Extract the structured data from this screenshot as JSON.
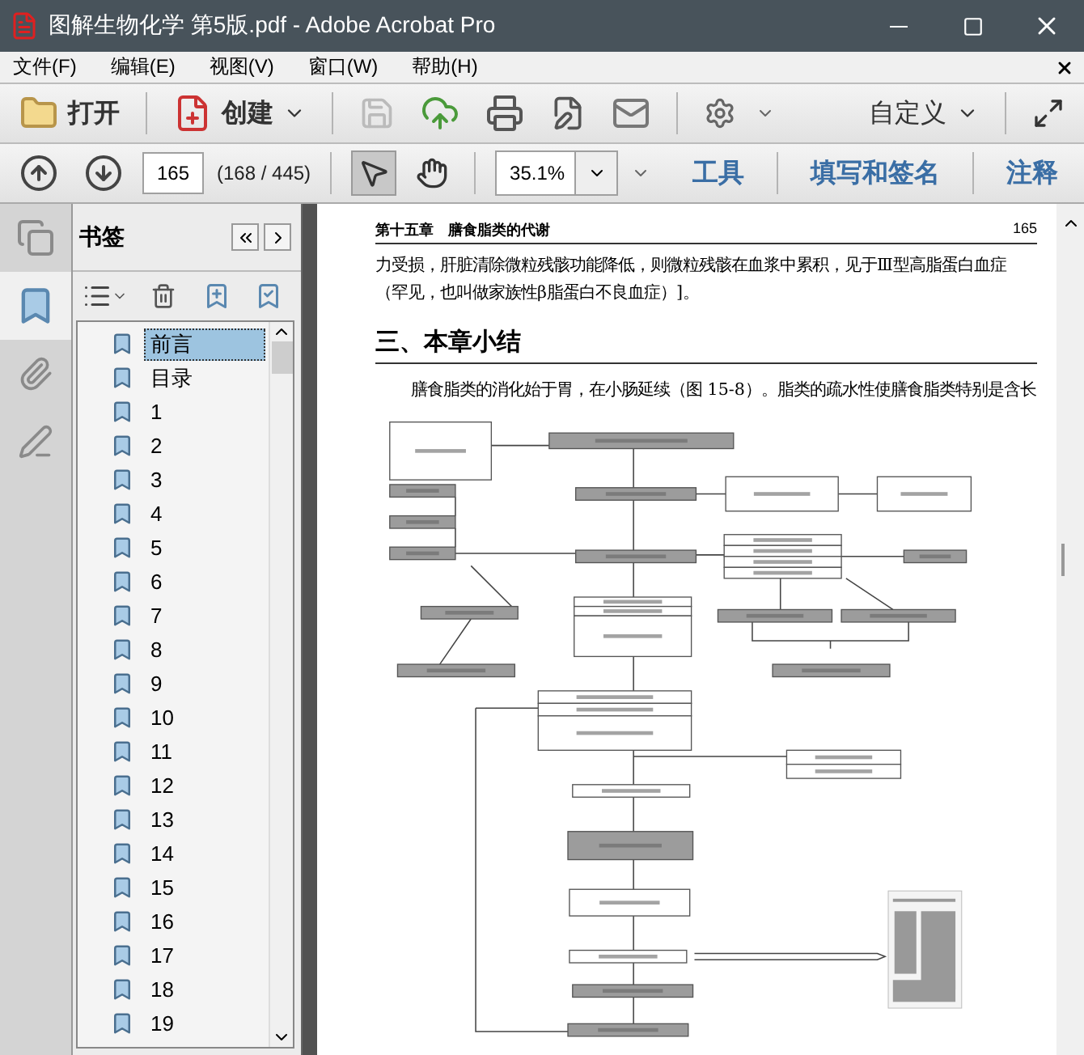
{
  "window": {
    "title": "图解生物化学 第5版.pdf - Adobe Acrobat Pro"
  },
  "menu": [
    "文件(F)",
    "编辑(E)",
    "视图(V)",
    "窗口(W)",
    "帮助(H)"
  ],
  "toolbar": {
    "open": "打开",
    "create": "创建",
    "customize": "自定义"
  },
  "nav": {
    "page": "165",
    "page_count": "(168 / 445)",
    "zoom": "35.1%",
    "links": [
      "工具",
      "填写和签名",
      "注释"
    ]
  },
  "sidebar": {
    "title": "书签",
    "bookmarks": [
      {
        "label": "前言",
        "selected": true
      },
      {
        "label": "目录",
        "selected": false
      },
      {
        "label": "1",
        "selected": false
      },
      {
        "label": "2",
        "selected": false
      },
      {
        "label": "3",
        "selected": false
      },
      {
        "label": "4",
        "selected": false
      },
      {
        "label": "5",
        "selected": false
      },
      {
        "label": "6",
        "selected": false
      },
      {
        "label": "7",
        "selected": false
      },
      {
        "label": "8",
        "selected": false
      },
      {
        "label": "9",
        "selected": false
      },
      {
        "label": "10",
        "selected": false
      },
      {
        "label": "11",
        "selected": false
      },
      {
        "label": "12",
        "selected": false
      },
      {
        "label": "13",
        "selected": false
      },
      {
        "label": "14",
        "selected": false
      },
      {
        "label": "15",
        "selected": false
      },
      {
        "label": "16",
        "selected": false
      },
      {
        "label": "17",
        "selected": false
      },
      {
        "label": "18",
        "selected": false
      },
      {
        "label": "19",
        "selected": false
      }
    ]
  },
  "page": {
    "running_head": "第十五章　膳食脂类的代谢",
    "page_number": "165",
    "blocks": [
      {
        "kind": "paragraph",
        "text": "力受损，肝脏清除微粒残骸功能降低，则微粒残骸在血浆中累积，见于Ⅲ型高脂蛋白血症（罕见，也叫做家族性β脂蛋白不良血症）]。"
      },
      {
        "kind": "heading",
        "text": "三、本章小结"
      },
      {
        "kind": "indented",
        "text": "膳食脂类的消化始于胃，在小肠延续（图 15-8）。脂类的疏水性使膳食脂类特别是含长"
      }
    ]
  }
}
